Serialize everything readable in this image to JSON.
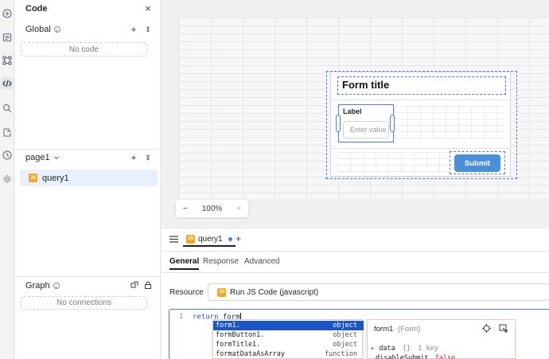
{
  "rail": {
    "icons": [
      "add-icon",
      "pages-icon",
      "components-icon",
      "code-icon",
      "search-icon",
      "state-icon",
      "history-icon",
      "settings-icon"
    ],
    "active": "code-icon"
  },
  "code_panel": {
    "title": "Code",
    "global": {
      "label": "Global",
      "empty_text": "No code"
    },
    "page": {
      "label": "page1"
    },
    "queries": [
      {
        "badge": "JS",
        "name": "query1"
      }
    ],
    "graph": {
      "label": "Graph",
      "empty_text": "No connections"
    }
  },
  "canvas": {
    "form": {
      "title": "Form title",
      "field_label": "Label",
      "field_placeholder": "Enter value",
      "submit_label": "Submit"
    },
    "zoom": {
      "minus": "−",
      "level": "100%",
      "plus": "+"
    }
  },
  "editor": {
    "query_tab": {
      "badge": "JS",
      "name": "query1"
    },
    "add_tab": "+",
    "tabs": [
      "General",
      "Response",
      "Advanced"
    ],
    "active_tab": "General",
    "resource": {
      "label": "Resource",
      "badge": "JS",
      "value": "Run JS Code (javascript)"
    },
    "code": {
      "line_number": "1",
      "keyword": "return",
      "text": "form"
    },
    "autocomplete": [
      {
        "name": "form1.",
        "type": "object"
      },
      {
        "name": "formButton1.",
        "type": "object"
      },
      {
        "name": "formTitle1.",
        "type": "object"
      },
      {
        "name": "formatDataAsArray",
        "type": "function"
      }
    ],
    "docs": {
      "name": "form1",
      "kind": "(Form)",
      "row1_key": "data",
      "row1_braces": "{}",
      "row1_meta": "1 key",
      "row2_key": "disableSubmit",
      "row2_value": "false"
    }
  },
  "colors": {
    "accent": "#4a7fd4",
    "submit": "#4a8fd8",
    "js_badge": "#f5a623",
    "selected_row": "#1a56c7"
  }
}
